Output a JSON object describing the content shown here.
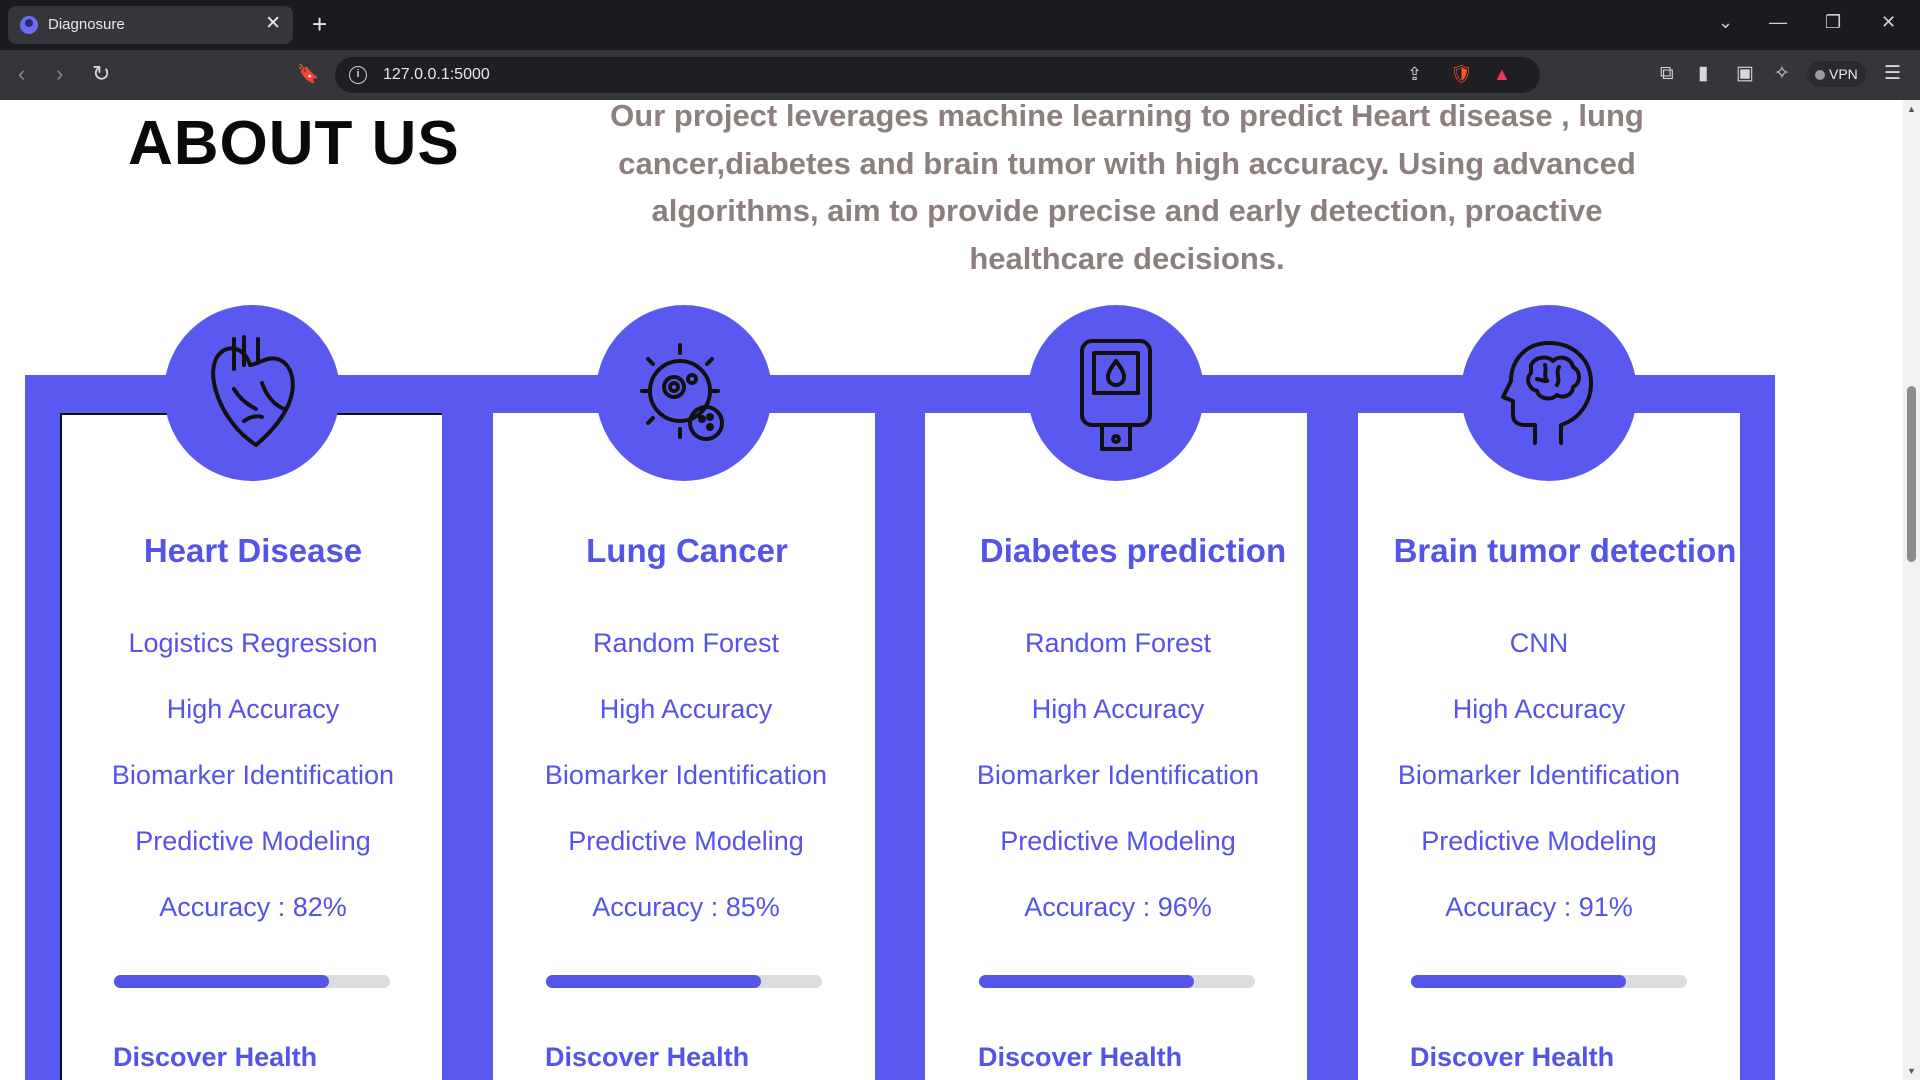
{
  "browser": {
    "tab_title": "Diagnosure",
    "tab_close": "✕",
    "new_tab": "+",
    "url": "127.0.0.1:5000",
    "vpn_label": "VPN"
  },
  "about": {
    "title": "ABOUT US",
    "description": "Our project leverages machine learning to predict Heart disease , lung cancer,diabetes and brain tumor with high accuracy. Using advanced algorithms, aim to provide precise and early detection, proactive healthcare decisions."
  },
  "cards": [
    {
      "icon": "heart-icon",
      "title": "Heart Disease",
      "features": [
        "Logistics Regression",
        "High Accuracy",
        "Biomarker Identification",
        "Predictive Modeling"
      ],
      "accuracy_label": "Accuracy : 82%",
      "progress": 0.78,
      "link": "Discover Health"
    },
    {
      "icon": "virus-cell-icon",
      "title": "Lung Cancer",
      "features": [
        "Random Forest",
        "High Accuracy",
        "Biomarker Identification",
        "Predictive Modeling"
      ],
      "accuracy_label": "Accuracy : 85%",
      "progress": 0.78,
      "link": "Discover Health"
    },
    {
      "icon": "glucose-meter-icon",
      "title": "Diabetes prediction",
      "features": [
        "Random Forest",
        "High Accuracy",
        "Biomarker Identification",
        "Predictive Modeling"
      ],
      "accuracy_label": "Accuracy : 96%",
      "progress": 0.78,
      "link": "Discover Health"
    },
    {
      "icon": "brain-head-icon",
      "title": "Brain tumor detection",
      "features": [
        "CNN",
        "High Accuracy",
        "Biomarker Identification",
        "Predictive Modeling"
      ],
      "accuracy_label": "Accuracy : 91%",
      "progress": 0.78,
      "link": "Discover Health"
    }
  ],
  "colors": {
    "accent": "#5959f0",
    "text_accent": "#5454e8",
    "about_text": "#8e7f7f"
  }
}
